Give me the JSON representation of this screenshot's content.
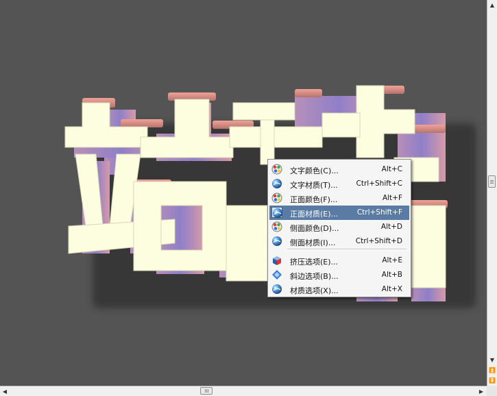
{
  "menu": {
    "items": [
      {
        "label": "文字颜色(C)...",
        "shortcut": "Alt+C",
        "icon": "color-palette-icon"
      },
      {
        "label": "文字材质(T)...",
        "shortcut": "Ctrl+Shift+C",
        "icon": "material-sphere-icon"
      },
      {
        "label": "正面颜色(F)...",
        "shortcut": "Alt+F",
        "icon": "color-palette-icon"
      },
      {
        "label": "正面材质(E)...",
        "shortcut": "Ctrl+Shift+F",
        "icon": "material-sphere-icon",
        "highlighted": true
      },
      {
        "label": "侧面颜色(D)...",
        "shortcut": "Alt+D",
        "icon": "color-palette-icon"
      },
      {
        "label": "侧面材质(I)...",
        "shortcut": "Ctrl+Shift+D",
        "icon": "material-sphere-icon"
      },
      {
        "label": "挤压选项(E)...",
        "shortcut": "Alt+E",
        "icon": "extrude-cube-icon"
      },
      {
        "label": "斜边选项(B)...",
        "shortcut": "Alt+B",
        "icon": "bevel-diamond-icon"
      },
      {
        "label": "材质选项(X)...",
        "shortcut": "Alt+X",
        "icon": "material-sphere-icon"
      }
    ]
  },
  "colors": {
    "canvas": "#545454",
    "text_face": "#fdfde0",
    "side_top": "#d98b82",
    "side_side": "#9d86c2",
    "menu_highlight": "#5a7ba4"
  }
}
